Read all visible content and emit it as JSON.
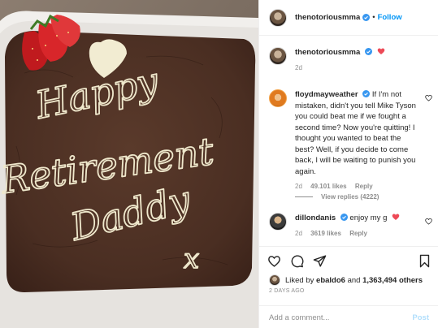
{
  "header": {
    "username": "thenotoriousmma",
    "separator": "•",
    "follow_label": "Follow"
  },
  "caption": {
    "username": "thenotoriousmma",
    "time": "2d"
  },
  "cake": {
    "lines": [
      "Happy",
      "Retirement",
      "Daddy",
      "x"
    ]
  },
  "comments": [
    {
      "username": "floydmayweather",
      "text": "If I'm not mistaken, didn't you tell Mike Tyson you could beat me if we fought a second time? Now you're quitting! I thought you wanted to beat the best? Well, if you decide to come back, I will be waiting to punish you again.",
      "time": "2d",
      "likes": "49.101 likes",
      "reply": "Reply",
      "view_replies": "View replies (4222)"
    },
    {
      "username": "dillondanis",
      "text": "enjoy my g",
      "time": "2d",
      "likes": "3619 likes",
      "reply": "Reply"
    }
  ],
  "likes": {
    "prefix": "Liked by",
    "user": "ebaldo6",
    "middle": "and",
    "count": "1,363,494 others"
  },
  "date": "2 DAYS AGO",
  "add_comment": {
    "placeholder": "Add a comment...",
    "post_label": "Post"
  },
  "colors": {
    "link": "#0095f6",
    "muted": "#8e8e8e",
    "heart": "#ed4956",
    "post_disabled": "#b2dffc"
  },
  "icons": [
    "verified-icon",
    "heart-icon",
    "comment-icon",
    "share-icon",
    "save-icon"
  ]
}
